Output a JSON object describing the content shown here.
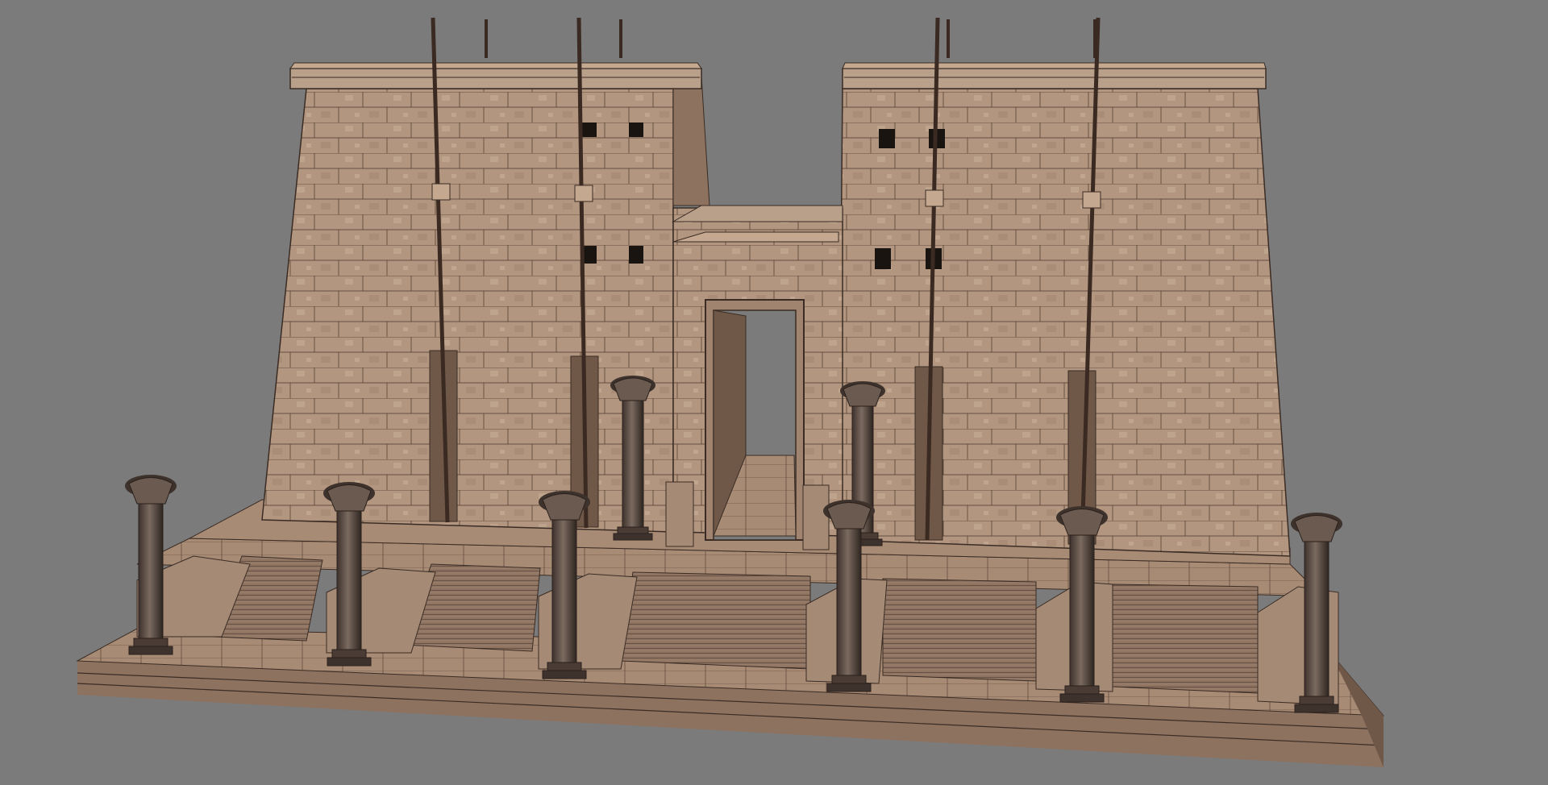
{
  "scene": {
    "subject": "egyptian-temple-pylon-3d-wireframe-render",
    "colors": {
      "background": "#7b7b7b",
      "stone": "#b39680",
      "stone_light": "#c4a890",
      "stone_dark": "#8d7260",
      "stone_shadow": "#6f5848",
      "wire": "#3a2c24",
      "pole": "#3b2a22",
      "column": "#6b5a50",
      "column_dark": "#3e322c",
      "opening": "#1a1410"
    },
    "counts": {
      "columns": 8,
      "flagpoles": 4,
      "staircases": 5,
      "wall_windows": 8
    }
  }
}
